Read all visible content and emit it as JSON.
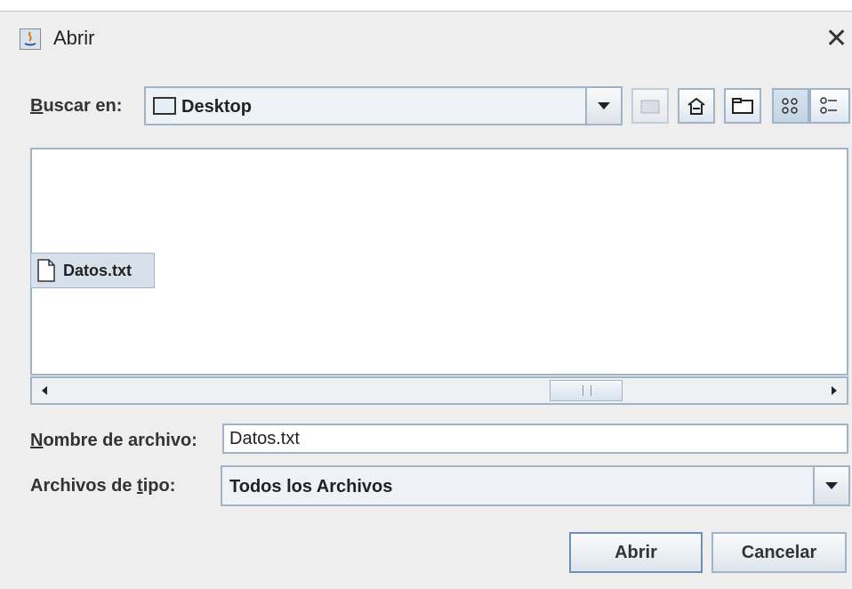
{
  "dialog": {
    "title": "Abrir"
  },
  "look_in": {
    "label_prefix": "",
    "label_mnemonic": "B",
    "label_rest": "uscar en:",
    "value": "Desktop"
  },
  "toolbar": {
    "up_icon": "up-folder-icon",
    "home_icon": "home-icon",
    "new_folder_icon": "new-folder-icon",
    "list_icon": "list-view-icon",
    "details_icon": "details-view-icon"
  },
  "files": [
    {
      "name": "Datos.txt",
      "selected": true,
      "icon": "file-icon"
    }
  ],
  "filename": {
    "label_mnemonic": "N",
    "label_rest": "ombre de archivo:",
    "value": "Datos.txt"
  },
  "filetype": {
    "label_before": "Archivos de ",
    "label_mnemonic": "t",
    "label_after": "ipo:",
    "value": "Todos los Archivos"
  },
  "buttons": {
    "open": "Abrir",
    "cancel": "Cancelar"
  },
  "colors": {
    "border": "#9fb4c8",
    "selection": "#d6e1ec",
    "background": "#eeeeee"
  }
}
